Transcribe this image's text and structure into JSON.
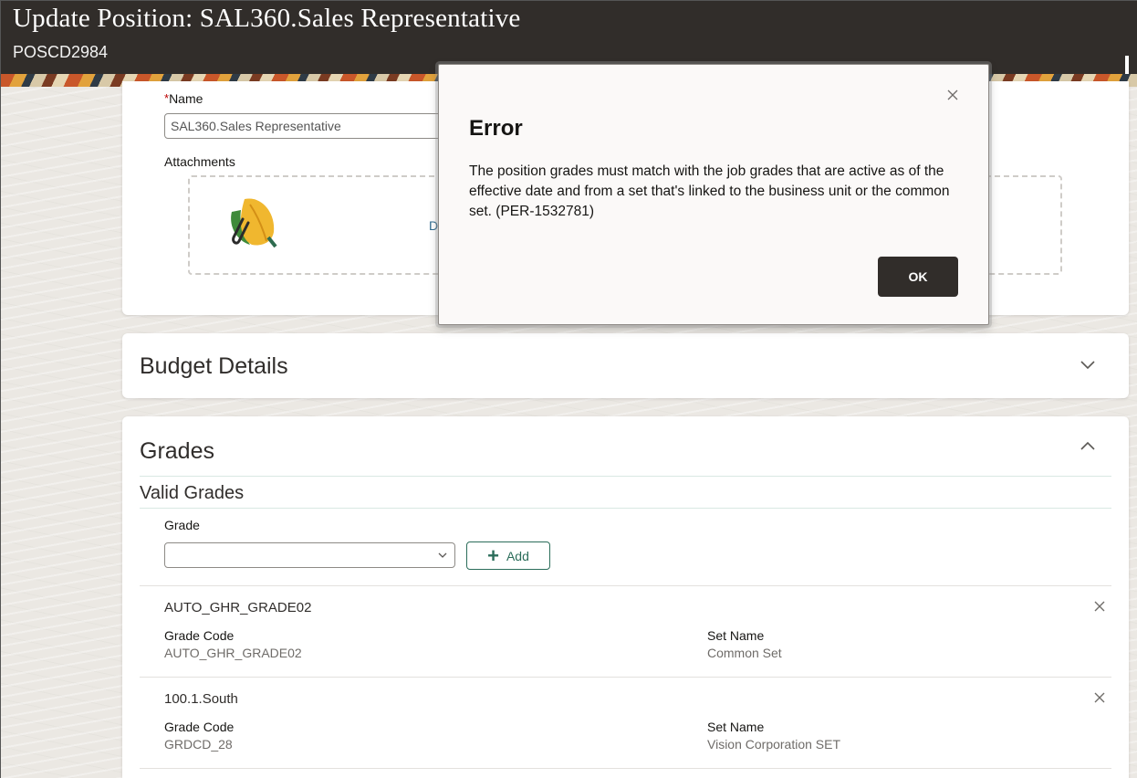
{
  "header": {
    "title": "Update Position: SAL360.Sales Representative",
    "subtitle": "POSCD2984"
  },
  "general": {
    "name_label": "Name",
    "name_required_marker": "*",
    "name_value": "SAL360.Sales Representative",
    "attachments_label": "Attachments",
    "dropzone_link_text": "D"
  },
  "budget": {
    "title": "Budget Details",
    "expand_icon": "chevron-down-icon"
  },
  "grades": {
    "title": "Grades",
    "collapse_icon": "chevron-up-icon",
    "valid_grades_title": "Valid Grades",
    "grade_label": "Grade",
    "grade_select_value": "",
    "add_label": "Add",
    "rows": [
      {
        "title": "AUTO_GHR_GRADE02",
        "grade_code_label": "Grade Code",
        "grade_code": "AUTO_GHR_GRADE02",
        "set_name_label": "Set Name",
        "set_name": "Common Set"
      },
      {
        "title": "100.1.South",
        "grade_code_label": "Grade Code",
        "grade_code": "GRDCD_28",
        "set_name_label": "Set Name",
        "set_name": "Vision Corporation SET"
      }
    ]
  },
  "dialog": {
    "title": "Error",
    "message": "The position grades must match with the job grades that are active as of the effective date and from a set that's linked to the business unit or the common set. (PER-1532781)",
    "ok_label": "OK",
    "close_icon": "close-icon"
  },
  "colors": {
    "header_bg": "#312d2a",
    "accent_green": "#2b6d5a",
    "button_dark": "#312d2a"
  }
}
